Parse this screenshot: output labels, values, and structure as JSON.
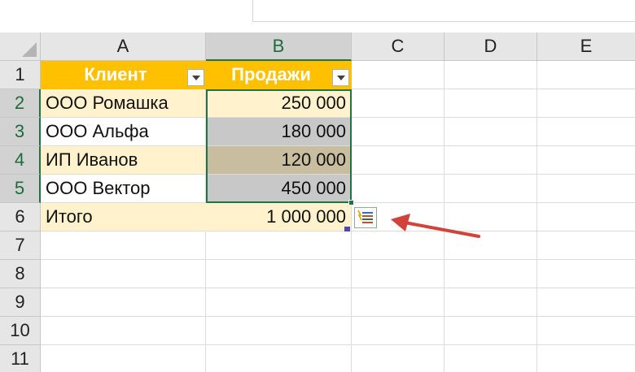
{
  "columns": [
    "A",
    "B",
    "C",
    "D",
    "E"
  ],
  "rows": [
    "1",
    "2",
    "3",
    "4",
    "5",
    "6",
    "7",
    "8",
    "9",
    "10",
    "11"
  ],
  "table": {
    "header": {
      "client": "Клиент",
      "sales": "Продажи"
    },
    "records": [
      {
        "client": "ООО Ромашка",
        "sales": "250 000"
      },
      {
        "client": "ООО Альфа",
        "sales": "180 000"
      },
      {
        "client": "ИП Иванов",
        "sales": "120 000"
      },
      {
        "client": "ООО Вектор",
        "sales": "450 000"
      }
    ],
    "total": {
      "label": "Итого",
      "value": "1 000 000"
    }
  },
  "selection": {
    "active_column": "B",
    "active_rows": [
      "2",
      "3",
      "4",
      "5"
    ]
  },
  "quick_analysis": {
    "icon": "quick-analysis-icon"
  },
  "annotation": {
    "arrow_color": "#d0423a"
  },
  "colors": {
    "header_fill": "#ffc000",
    "band_fill": "#fff2cc",
    "selection_border": "#217346"
  }
}
